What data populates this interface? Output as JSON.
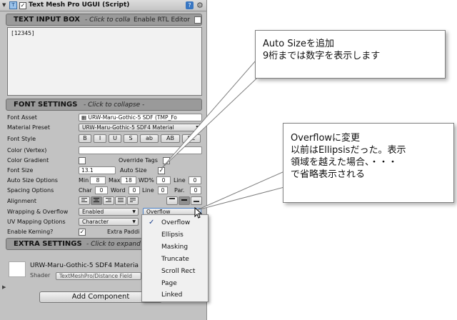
{
  "component": {
    "title": "Text Mesh Pro UGUI (Script)",
    "checkbox": "✓",
    "help": "?",
    "gear": "⚙"
  },
  "text_input": {
    "section_label": "TEXT INPUT BOX",
    "hint_prefix": "- Click to colla",
    "rtl_label": "Enable RTL Editor",
    "value": "[12345]"
  },
  "font_settings": {
    "section_label": "FONT SETTINGS",
    "hint": "- Click to collapse -",
    "font_asset": {
      "label": "Font Asset",
      "value": "URW-Maru-Gothic-5 SDF (TMP_Fo"
    },
    "material_preset": {
      "label": "Material Preset",
      "value": "URW-Maru-Gothic-5 SDF4 Material"
    },
    "font_style": {
      "label": "Font Style",
      "buttons": [
        "B",
        "I",
        "U",
        "S",
        "ab",
        "AB",
        "SC"
      ]
    },
    "color_vertex": {
      "label": "Color (Vertex)"
    },
    "color_gradient": {
      "label": "Color Gradient",
      "override_label": "Override Tags"
    },
    "font_size": {
      "label": "Font Size",
      "value": "13.1",
      "auto_label": "Auto Size",
      "auto_checked": "✓"
    },
    "auto_size_options": {
      "label": "Auto Size Options",
      "min_label": "Min",
      "min_value": "8",
      "max_label": "Max",
      "max_value": "18",
      "wd_label": "WD%",
      "wd_value": "0",
      "line_label": "Line",
      "line_value": "0"
    },
    "spacing_options": {
      "label": "Spacing Options",
      "char_label": "Char",
      "char_value": "0",
      "word_label": "Word",
      "word_value": "0",
      "line_label": "Line",
      "line_value": "0",
      "par_label": "Par.",
      "par_value": "0"
    },
    "alignment": {
      "label": "Alignment"
    },
    "wrapping": {
      "label": "Wrapping & Overflow",
      "wrap_value": "Enabled",
      "overflow_value": "Overflow"
    },
    "uv_mapping": {
      "label": "UV Mapping Options",
      "value": "Character"
    },
    "kerning": {
      "label": "Enable Kerning?",
      "checked": "✓",
      "extra_label": "Extra Paddi"
    }
  },
  "extra_settings": {
    "section_label": "EXTRA SETTINGS",
    "hint": "- Click to expand"
  },
  "material": {
    "name": "URW-Maru-Gothic-5 SDF4 Materia",
    "shader_label": "Shader",
    "shader_value": "TextMeshPro/Distance Field"
  },
  "add_component": {
    "label": "Add Component"
  },
  "overflow_menu": {
    "selected": "Overflow",
    "check": "✓",
    "options": [
      "Overflow",
      "Ellipsis",
      "Masking",
      "Truncate",
      "Scroll Rect",
      "Page",
      "Linked"
    ]
  },
  "callout_autosize": {
    "line1": "Auto Sizeを追加",
    "line2": "9桁までは数字を表示します"
  },
  "callout_overflow": {
    "line1": "Overflowに変更",
    "line2": "以前はEllipsisだった。表示",
    "line3": "領域を越えた場合、・・・",
    "line4": "で省略表示される"
  },
  "colors": {
    "panel": "#c2c2c2",
    "section_bar": "#9a9a9a",
    "callout_border": "#7f7f7f",
    "help_icon": "#3876c2"
  }
}
